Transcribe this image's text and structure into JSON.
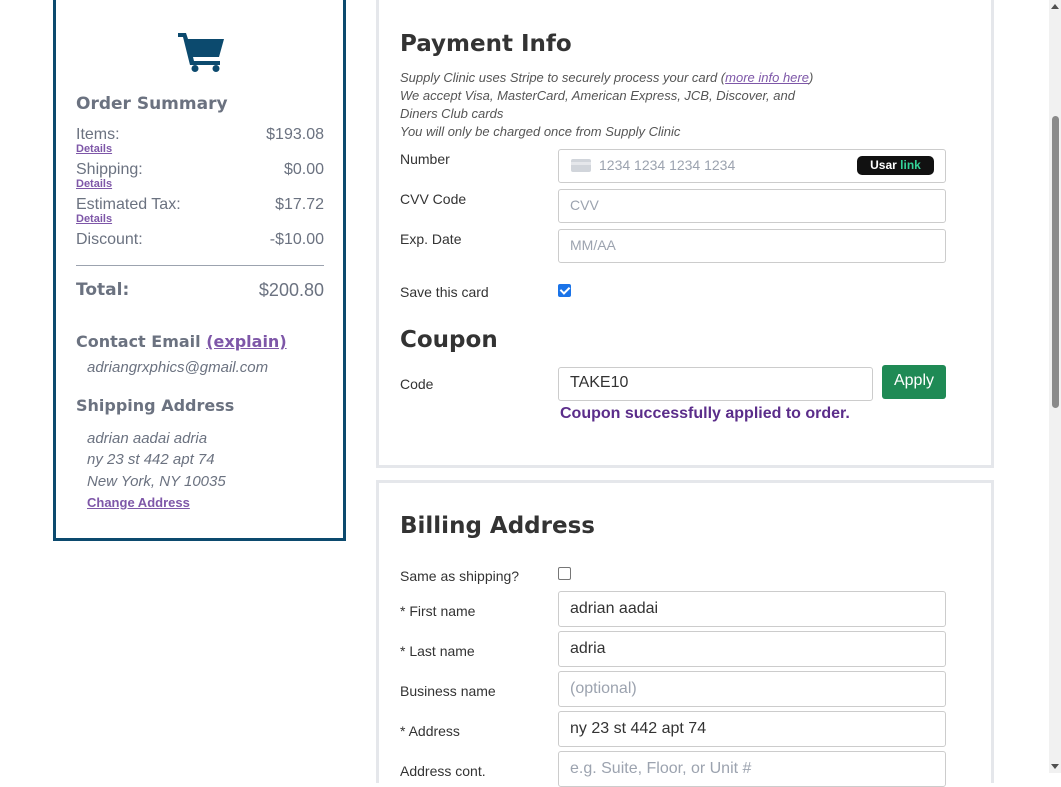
{
  "summary": {
    "title": "Order Summary",
    "items_label": "Items:",
    "items_value": "$193.08",
    "shipping_label": "Shipping:",
    "shipping_value": "$0.00",
    "tax_label": "Estimated Tax:",
    "tax_value": "$17.72",
    "discount_label": "Discount:",
    "discount_value": "-$10.00",
    "details_label": "Details",
    "total_label": "Total:",
    "total_value": "$200.80",
    "contact_heading": "Contact Email",
    "explain_link": "(explain)",
    "email": "adriangrxphics@gmail.com",
    "shipping_heading": "Shipping Address",
    "address_lines": [
      "adrian aadai adria",
      "ny 23 st 442 apt 74",
      "New York, NY 10035"
    ],
    "change_address": "Change Address",
    "icon": "shopping-cart-icon"
  },
  "payment": {
    "title": "Payment Info",
    "note_line1_pre": "Supply Clinic uses Stripe to securely process your card (",
    "note_link": "more info here",
    "note_line1_post": ")",
    "note_line2": "We accept Visa, MasterCard, American Express, JCB, Discover, and",
    "note_line3": "Diners Club cards",
    "note_line4": "You will only be charged once from Supply Clinic",
    "number_label": "Number",
    "number_placeholder": "1234 1234 1234 1234",
    "link_badge_pre": "Usar",
    "link_badge_green": "link",
    "cvv_label": "CVV Code",
    "cvv_placeholder": "CVV",
    "exp_label": "Exp. Date",
    "exp_placeholder": "MM/AA",
    "save_label": "Save this card",
    "save_checked": true
  },
  "coupon": {
    "title": "Coupon",
    "code_label": "Code",
    "code_value": "TAKE10",
    "apply_label": "Apply",
    "success_message": "Coupon successfully applied to order."
  },
  "billing": {
    "title": "Billing Address",
    "same_label": "Same as shipping?",
    "same_checked": false,
    "first_name_label": "* First name",
    "first_name_value": "adrian aadai",
    "last_name_label": "* Last name",
    "last_name_value": "adria",
    "business_label": "Business name",
    "business_placeholder": "(optional)",
    "address_label": "* Address",
    "address_value": "ny 23 st 442 apt 74",
    "address_cont_label": "Address cont.",
    "address_cont_placeholder": "e.g. Suite, Floor, or Unit #"
  },
  "colors": {
    "summary_border": "#0c4a6e",
    "link_purple": "#7e57a8",
    "apply_green": "#1f8a55",
    "success_purple": "#5b2d8a"
  }
}
